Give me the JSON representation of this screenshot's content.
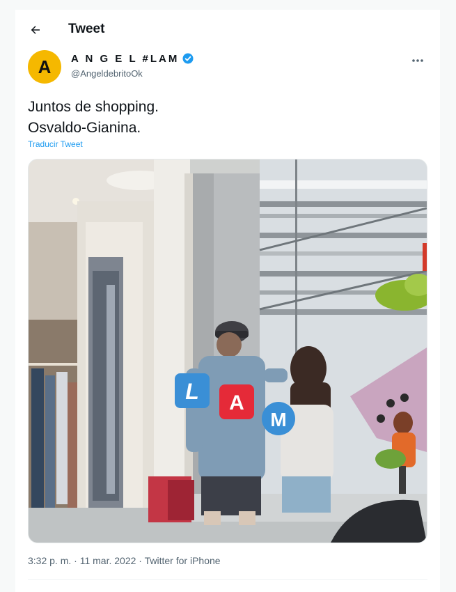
{
  "header": {
    "title": "Tweet",
    "back_icon": "arrow-left-icon"
  },
  "author": {
    "avatar_letter": "A",
    "avatar_color": "#f5b800",
    "display_name": "A N G E L #LAM",
    "handle": "@AngeldebritoOk",
    "verified": true,
    "verified_color": "#1d9bf0"
  },
  "tweet": {
    "line1": "Juntos de shopping.",
    "line2": "Osvaldo-Gianina.",
    "translate_label": "Traducir Tweet"
  },
  "media": {
    "watermark": [
      "L",
      "A",
      "M"
    ],
    "watermark_colors": [
      "#3a8fd6",
      "#e52a38",
      "#3a8fd6"
    ]
  },
  "meta": {
    "time": "3:32 p. m.",
    "separator": " · ",
    "date": "11 mar. 2022",
    "source": "Twitter for iPhone"
  },
  "colors": {
    "link": "#1d9bf0",
    "muted": "#536471",
    "text": "#0f1419"
  }
}
